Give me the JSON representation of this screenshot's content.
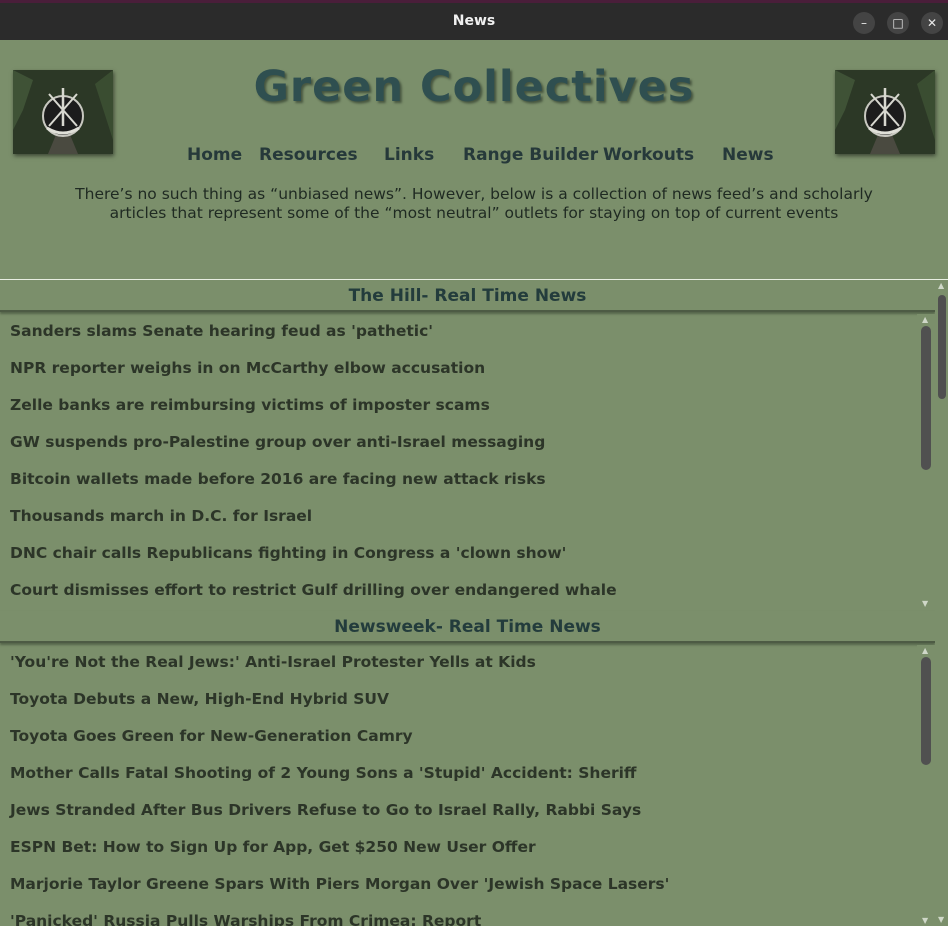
{
  "window": {
    "title": "News",
    "minimize_glyph": "–",
    "maximize_glyph": "□",
    "close_glyph": "✕"
  },
  "site": {
    "title": "Green Collectives",
    "logo_left_icon": "special-forces-crest-icon",
    "logo_right_icon": "special-forces-crest-icon"
  },
  "nav": {
    "items": [
      {
        "label": "Home"
      },
      {
        "label": "Resources"
      },
      {
        "label": "Links"
      },
      {
        "label": "Range Builder"
      },
      {
        "label": "Workouts"
      },
      {
        "label": "News"
      }
    ]
  },
  "intro": {
    "line1": "There’s no such thing as “unbiased news”. However, below is a collection of news feed’s and scholarly",
    "line2": "articles that represent some of the “most neutral” outlets for staying on top of current events"
  },
  "feeds": [
    {
      "title": "The Hill- Real Time News",
      "items": [
        "Sanders slams Senate hearing feud as 'pathetic'",
        "NPR reporter weighs in on McCarthy elbow accusation",
        "Zelle banks are reimbursing victims of imposter scams",
        "GW suspends pro-Palestine group over anti-Israel messaging",
        "Bitcoin wallets made before 2016 are facing new attack risks",
        "Thousands march in D.C. for Israel",
        "DNC chair calls Republicans fighting in Congress a 'clown show'",
        "Court dismisses effort to restrict Gulf drilling over endangered whale"
      ]
    },
    {
      "title": "Newsweek- Real Time News",
      "items": [
        "'You're Not the Real Jews:' Anti-Israel Protester Yells at Kids",
        "Toyota Debuts a New, High-End Hybrid SUV",
        "Toyota Goes Green for New-Generation Camry",
        "Mother Calls Fatal Shooting of 2 Young Sons a 'Stupid' Accident: Sheriff",
        "Jews Stranded After Bus Drivers Refuse to Go to Israel Rally, Rabbi Says",
        "ESPN Bet: How to Sign Up for App, Get $250 New User Offer",
        "Marjorie Taylor Greene Spars With Piers Morgan Over 'Jewish Space Lasers'",
        "'Panicked' Russia Pulls Warships From Crimea: Report"
      ]
    }
  ],
  "colors": {
    "background": "#7b8f6b",
    "title_text": "#2f4f50",
    "nav_text": "#26393a",
    "item_text": "#2c3528",
    "titlebar": "#2b2b2b"
  }
}
